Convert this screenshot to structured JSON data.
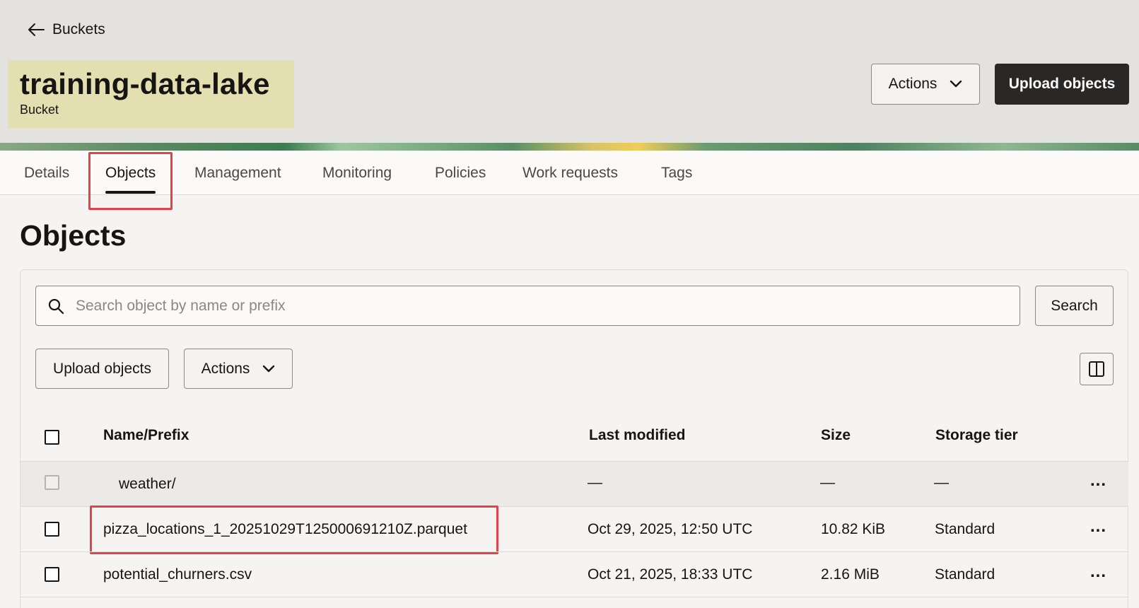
{
  "header": {
    "back_label": "Buckets",
    "title": "training-data-lake",
    "subtitle": "Bucket",
    "actions_label": "Actions",
    "upload_label": "Upload objects"
  },
  "tabs": [
    {
      "label": "Details"
    },
    {
      "label": "Objects",
      "active": true
    },
    {
      "label": "Management"
    },
    {
      "label": "Monitoring"
    },
    {
      "label": "Policies"
    },
    {
      "label": "Work requests"
    },
    {
      "label": "Tags"
    }
  ],
  "section": {
    "title": "Objects"
  },
  "search": {
    "placeholder": "Search object by name or prefix",
    "value": "",
    "button_label": "Search"
  },
  "toolbar": {
    "upload_label": "Upload objects",
    "actions_label": "Actions"
  },
  "table": {
    "columns": [
      "Name/Prefix",
      "Last modified",
      "Size",
      "Storage tier"
    ],
    "rows": [
      {
        "name": "weather/",
        "modified": "—",
        "size": "—",
        "tier": "—",
        "type": "folder"
      },
      {
        "name": "pizza_locations_1_20251029T125000691210Z.parquet",
        "modified": "Oct 29, 2025, 12:50 UTC",
        "size": "10.82 KiB",
        "tier": "Standard",
        "type": "object"
      },
      {
        "name": "potential_churners.csv",
        "modified": "Oct 21, 2025, 18:33 UTC",
        "size": "2.16 MiB",
        "tier": "Standard",
        "type": "object"
      }
    ],
    "row_menu": "..."
  },
  "colors": {
    "highlight": "#e0434a",
    "title_bg": "#e3dfb1",
    "primary_button": "#2a2826"
  }
}
